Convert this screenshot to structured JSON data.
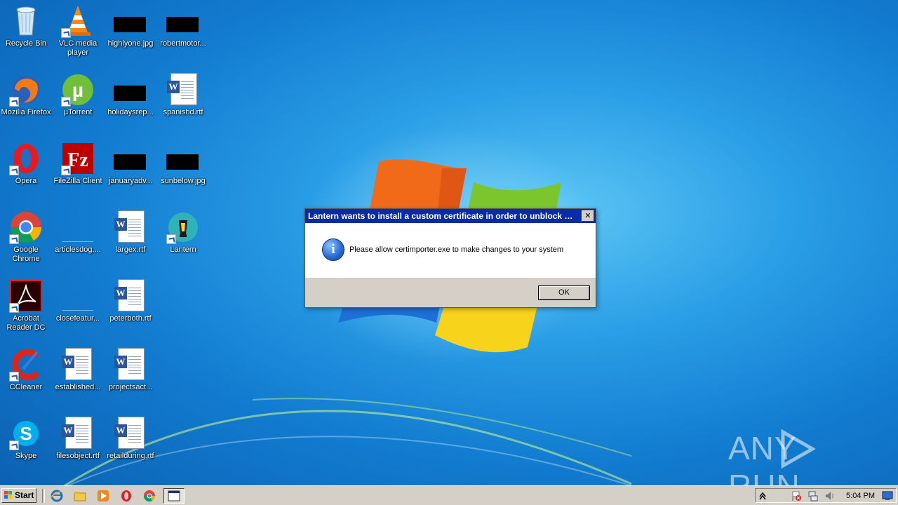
{
  "desktop": {
    "icons": [
      {
        "label": "Recycle Bin"
      },
      {
        "label": "VLC media player"
      },
      {
        "label": "highlyone.jpg"
      },
      {
        "label": "robertmotor..."
      },
      {
        "label": "Mozilla Firefox"
      },
      {
        "label": "µTorrent"
      },
      {
        "label": "holidaysrep..."
      },
      {
        "label": "spanishd.rtf"
      },
      {
        "label": "Opera"
      },
      {
        "label": "FileZilla Client"
      },
      {
        "label": "januaryadv..."
      },
      {
        "label": "sunbelow.jpg"
      },
      {
        "label": "Google Chrome"
      },
      {
        "label": "articlesdog...."
      },
      {
        "label": "largex.rtf"
      },
      {
        "label": "Lantern"
      },
      {
        "label": "Acrobat Reader DC"
      },
      {
        "label": "closefeatur..."
      },
      {
        "label": "peterboth.rtf"
      },
      {
        "label": "CCleaner"
      },
      {
        "label": "established..."
      },
      {
        "label": "projectsact..."
      },
      {
        "label": "Skype"
      },
      {
        "label": "filesobject.rtf"
      },
      {
        "label": "retailduring.rtf"
      }
    ]
  },
  "dialog": {
    "title": "Lantern wants to install a custom certificate in order to unblock yo...",
    "close_label": "✕",
    "icon": "info-icon",
    "message": "Please allow certimporter.exe to make changes to your system",
    "ok_label": "OK"
  },
  "watermark": {
    "left": "ANY",
    "right": "RUN"
  },
  "taskbar": {
    "start_label": "Start",
    "pinned": [
      "ie-icon",
      "explorer-icon",
      "media-player-icon",
      "opera-icon",
      "chrome-icon",
      "window-icon"
    ],
    "tray_icons": [
      "show-hidden-icon",
      "flag-warning-icon",
      "network-icon",
      "volume-icon"
    ],
    "clock": "5:04 PM"
  },
  "colors": {
    "title_bar": "#0a2aa8",
    "dialog_face": "#d4d0c8",
    "desktop": "#127cd0"
  }
}
